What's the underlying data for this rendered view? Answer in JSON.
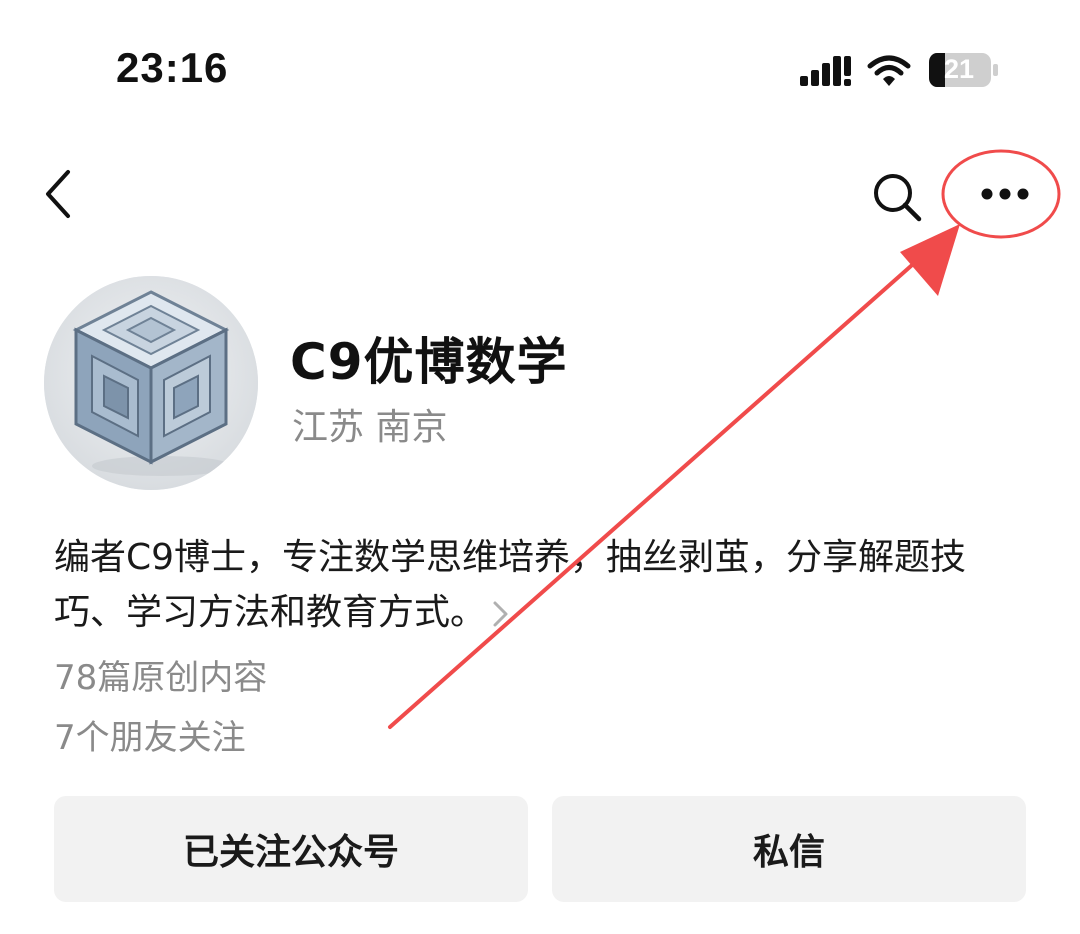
{
  "status_bar": {
    "time": "23:16",
    "battery_level": "21",
    "icons": [
      "signal-icon",
      "wifi-icon",
      "battery-icon"
    ]
  },
  "nav": {
    "back_icon": "chevron-left-icon",
    "search_icon": "search-icon",
    "more_icon": "more-dots-icon"
  },
  "profile": {
    "name": "C9优博数学",
    "location": "江苏 南京",
    "bio_line1": "编者C9博士，专注数学思维培养，抽丝剥茧，分享解题技",
    "bio_line2": "巧、学习方法和教育方式。",
    "original_count": "78篇原创内容",
    "friends_following": "7个朋友关注"
  },
  "actions": {
    "follow_label": "已关注公众号",
    "message_label": "私信"
  },
  "colors": {
    "annotation": "#f04b4b",
    "secondary_text": "#8a8a8a",
    "button_bg": "#f2f2f2"
  }
}
